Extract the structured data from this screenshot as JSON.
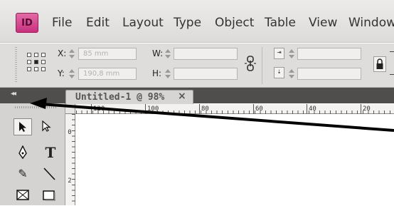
{
  "app": {
    "logo_text": "ID",
    "brand_color": "#d2458f"
  },
  "menu": {
    "items": [
      "File",
      "Edit",
      "Layout",
      "Type",
      "Object",
      "Table",
      "View",
      "Window"
    ]
  },
  "control_panel": {
    "x_label": "X:",
    "x_value": "85 mm",
    "y_label": "Y:",
    "y_value": "190,8 mm",
    "w_label": "W:",
    "w_value": "",
    "h_label": "H:",
    "h_value": "",
    "link_icon": "chain-link-icon",
    "stroke_icons": [
      "width-icon",
      "height-icon"
    ],
    "lock_icon": "lock-icon"
  },
  "panel_bar": {
    "collapse_label": "◂◂"
  },
  "document_tab": {
    "title": "Untitled-1 @ 98%",
    "close": "×"
  },
  "tools": [
    {
      "name": "selection-tool",
      "glyph": "➤"
    },
    {
      "name": "direct-selection-tool",
      "glyph": "↖"
    },
    {
      "name": "pen-tool",
      "glyph": "✒"
    },
    {
      "name": "type-tool",
      "glyph": "T"
    },
    {
      "name": "pencil-tool",
      "glyph": "✎"
    },
    {
      "name": "line-tool",
      "glyph": "╲"
    },
    {
      "name": "rectangle-frame-tool",
      "glyph": "⊠"
    },
    {
      "name": "rectangle-tool",
      "glyph": "▭"
    }
  ],
  "rulers": {
    "horizontal_labels": [
      "120",
      "100",
      "80",
      "60",
      "40",
      "20"
    ],
    "vertical_labels": [
      "0",
      "2"
    ]
  },
  "annotation": {
    "arrow_color": "#000000"
  }
}
